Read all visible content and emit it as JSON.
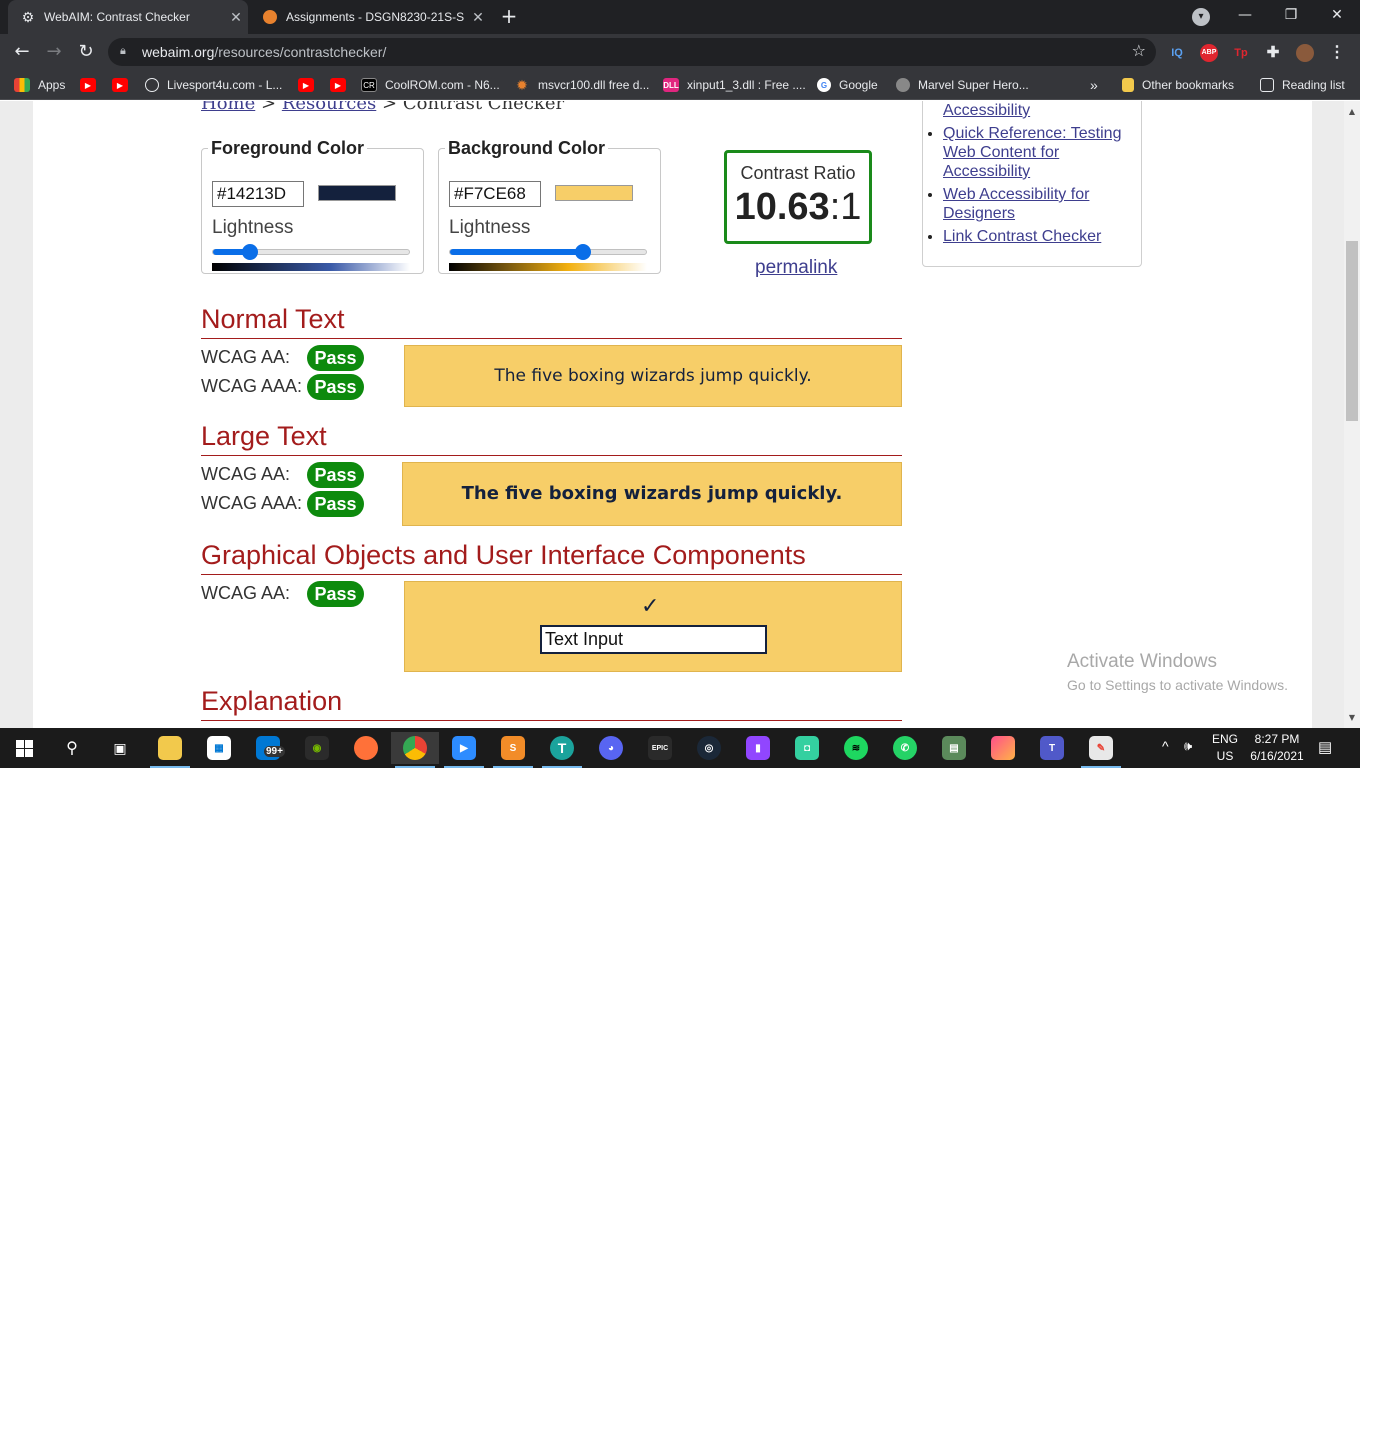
{
  "browser": {
    "tabs": [
      {
        "title": "WebAIM: Contrast Checker",
        "active": true
      },
      {
        "title": "Assignments - DSGN8230-21S-S",
        "active": false
      }
    ],
    "new_tab": "+",
    "url_domain": "webaim.org",
    "url_path": "/resources/contrastchecker/",
    "extensions": [
      "IQ",
      "ABP",
      "Tp"
    ],
    "bookmarks": [
      {
        "label": "Apps",
        "icon": "apps-grid-icon"
      },
      {
        "label": "",
        "icon": "youtube-icon"
      },
      {
        "label": "",
        "icon": "youtube-icon"
      },
      {
        "label": "Livesport4u.com - L...",
        "icon": "globe-icon"
      },
      {
        "label": "",
        "icon": "youtube-icon"
      },
      {
        "label": "",
        "icon": "youtube-icon"
      },
      {
        "label": "CoolROM.com - N6...",
        "icon": "coolrom-icon"
      },
      {
        "label": "msvcr100.dll free d...",
        "icon": "gear-icon"
      },
      {
        "label": "xinput1_3.dll : Free ....",
        "icon": "dll-icon"
      },
      {
        "label": "Google",
        "icon": "google-icon"
      },
      {
        "label": "Marvel Super Hero...",
        "icon": "marvel-icon"
      }
    ],
    "more_bookmarks": "»",
    "other_bookmarks": "Other bookmarks",
    "reading_list": "Reading list"
  },
  "page": {
    "breadcrumb": {
      "home": "Home",
      "sep": ">",
      "resources": "Resources",
      "current": "Contrast Checker"
    },
    "foreground": {
      "legend": "Foreground Color",
      "hex": "#14213D",
      "lightness_label": "Lightness",
      "lightness_fraction": 0.19
    },
    "background": {
      "legend": "Background Color",
      "hex": "#F7CE68",
      "lightness_label": "Lightness",
      "lightness_fraction": 0.68
    },
    "contrast": {
      "label": "Contrast Ratio",
      "value": "10.63",
      "suffix": ":1"
    },
    "permalink": "permalink",
    "sidebar_links": [
      "Contrast and Color Accessibility",
      "Quick Reference: Testing Web Content for Accessibility",
      "Web Accessibility for Designers",
      "Link Contrast Checker"
    ],
    "normal_text": {
      "heading": "Normal Text",
      "aa_label": "WCAG AA:",
      "aa_result": "Pass",
      "aaa_label": "WCAG AAA:",
      "aaa_result": "Pass",
      "sample": "The five boxing wizards jump quickly."
    },
    "large_text": {
      "heading": "Large Text",
      "aa_label": "WCAG AA:",
      "aa_result": "Pass",
      "aaa_label": "WCAG AAA:",
      "aaa_result": "Pass",
      "sample": "The five boxing wizards jump quickly."
    },
    "graphical": {
      "heading": "Graphical Objects and User Interface Components",
      "aa_label": "WCAG AA:",
      "aa_result": "Pass",
      "checkmark": "✓",
      "input_value": "Text Input"
    },
    "explanation": {
      "heading": "Explanation"
    },
    "colors": {
      "pass": "#0d8a0d",
      "heading": "#a31c1c",
      "link": "#3e3e8e",
      "ratio_border": "#1a8a1a"
    }
  },
  "watermark": {
    "title": "Activate Windows",
    "subtitle": "Go to Settings to activate Windows."
  },
  "taskbar": {
    "apps": [
      "windows-start-icon",
      "search-icon",
      "task-view-icon",
      "file-explorer-icon",
      "microsoft-store-icon",
      "mail-icon",
      "nvidia-icon",
      "firefox-icon",
      "chrome-icon",
      "zoom-icon",
      "sublime-icon",
      "typora-icon",
      "discord-icon",
      "epic-games-icon",
      "steam-icon",
      "twitch-icon",
      "webcam-app-icon",
      "spotify-icon",
      "whatsapp-icon",
      "network-app-icon",
      "photo-app-icon",
      "teams-icon",
      "paint-icon"
    ],
    "mail_badge": "99+",
    "language": "ENG",
    "region": "US",
    "time": "8:27 PM",
    "date": "6/16/2021"
  }
}
